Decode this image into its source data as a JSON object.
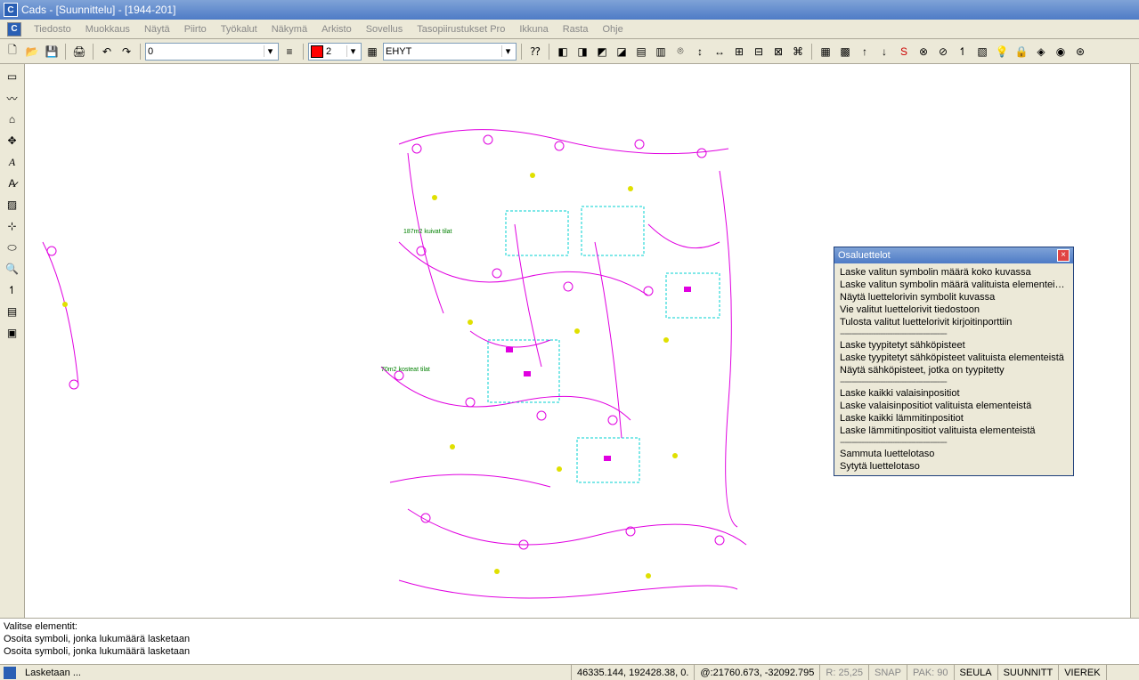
{
  "title": "Cads - [Suunnittelu] - [1944-201]",
  "menu": [
    "Tiedosto",
    "Muokkaus",
    "Näytä",
    "Piirto",
    "Työkalut",
    "Näkymä",
    "Arkisto",
    "Sovellus",
    "Tasopiirustukset Pro",
    "Ikkuna",
    "Rasta",
    "Ohje"
  ],
  "toolbar": {
    "layer_combo": "0",
    "color_combo": "2",
    "line_combo": "EHYT"
  },
  "popup": {
    "title": "Osaluettelot",
    "groups": [
      [
        "Laske valitun symbolin määrä koko kuvassa",
        "Laske valitun symbolin määrä valituista elementeistä",
        "Näytä luettelorivin symbolit kuvassa",
        "Vie valitut luettelorivit tiedostoon",
        "Tulosta valitut luettelorivit kirjoitinporttiin"
      ],
      [
        "Laske tyypitetyt sähköpisteet",
        "Laske tyypitetyt sähköpisteet valituista elementeistä",
        "Näytä sähköpisteet, jotka on tyypitetty"
      ],
      [
        "Laske kaikki valaisinpositiot",
        "Laske valaisinpositiot valituista elementeistä",
        "Laske kaikki lämmitinpositiot",
        "Laske lämmitinpositiot valituista elementeistä"
      ],
      [
        "Sammuta luettelotaso",
        "Sytytä luettelotaso"
      ]
    ]
  },
  "commandline": [
    "Valitse elementit:",
    "Osoita symboli, jonka lukumäärä lasketaan",
    "Osoita symboli, jonka lukumäärä lasketaan"
  ],
  "status": {
    "task": "Lasketaan ...",
    "coords1": "46335.144, 192428.38, 0.",
    "coords2": "@:21760.673, -32092.795",
    "coords3": "R: 25,25",
    "snap": "SNAP",
    "pak": "PAK: 90",
    "seula": "SEULA",
    "suunnitt": "SUUNNITT",
    "vierek": "VIEREK"
  },
  "drawing_labels": {
    "room1": "187m2 kuivat tilat",
    "room2": "70m2 kosteat tilat"
  }
}
